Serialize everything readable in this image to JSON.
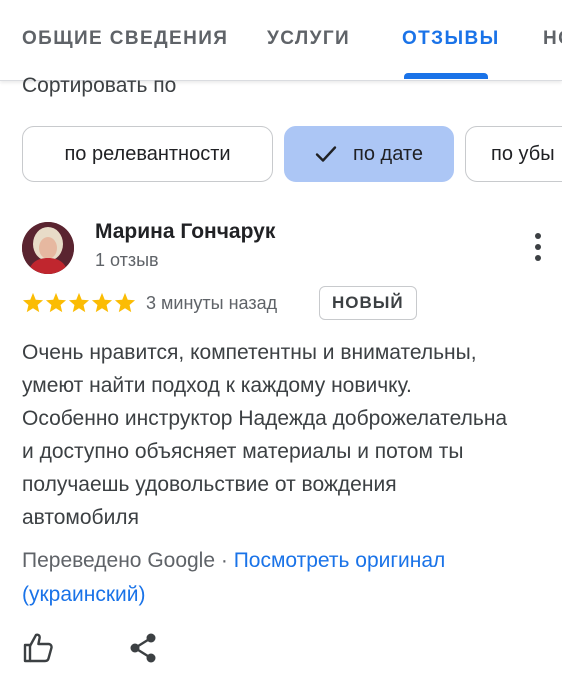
{
  "tabs": [
    {
      "label": "ОБЩИЕ СВЕДЕНИЯ"
    },
    {
      "label": "УСЛУГИ"
    },
    {
      "label": "ОТЗЫВЫ"
    },
    {
      "label": "НО"
    }
  ],
  "active_tab_index": 2,
  "sort": {
    "label": "Сортировать по",
    "chips": [
      {
        "label": "по релевантности",
        "selected": false
      },
      {
        "label": "по дате",
        "selected": true
      },
      {
        "label": "по убы",
        "selected": false
      }
    ]
  },
  "review": {
    "author": "Марина Гончарук",
    "reviews_count": "1 отзыв",
    "rating": 5,
    "time": "3 минуты назад",
    "badge": "НОВЫЙ",
    "text_lines": [
      "Очень нравится, компетентны и внимательны,",
      "умеют найти подход к каждому новичку.",
      "Особенно инструктор Надежда доброжелательна",
      "и доступно объясняет материалы и потом ты",
      "получаешь удовольствие от вождения",
      "автомобиля"
    ],
    "translated_by": "Переведено Google",
    "separator": " · ",
    "view_original": "Посмотреть оригинал (украинский)"
  },
  "colors": {
    "accent": "#1a73e8",
    "selected_chip": "#acc6f5",
    "star": "#fbbc04"
  },
  "icons": [
    "check-icon",
    "more-vert-icon",
    "star-icon",
    "thumb-up-icon",
    "share-icon"
  ]
}
